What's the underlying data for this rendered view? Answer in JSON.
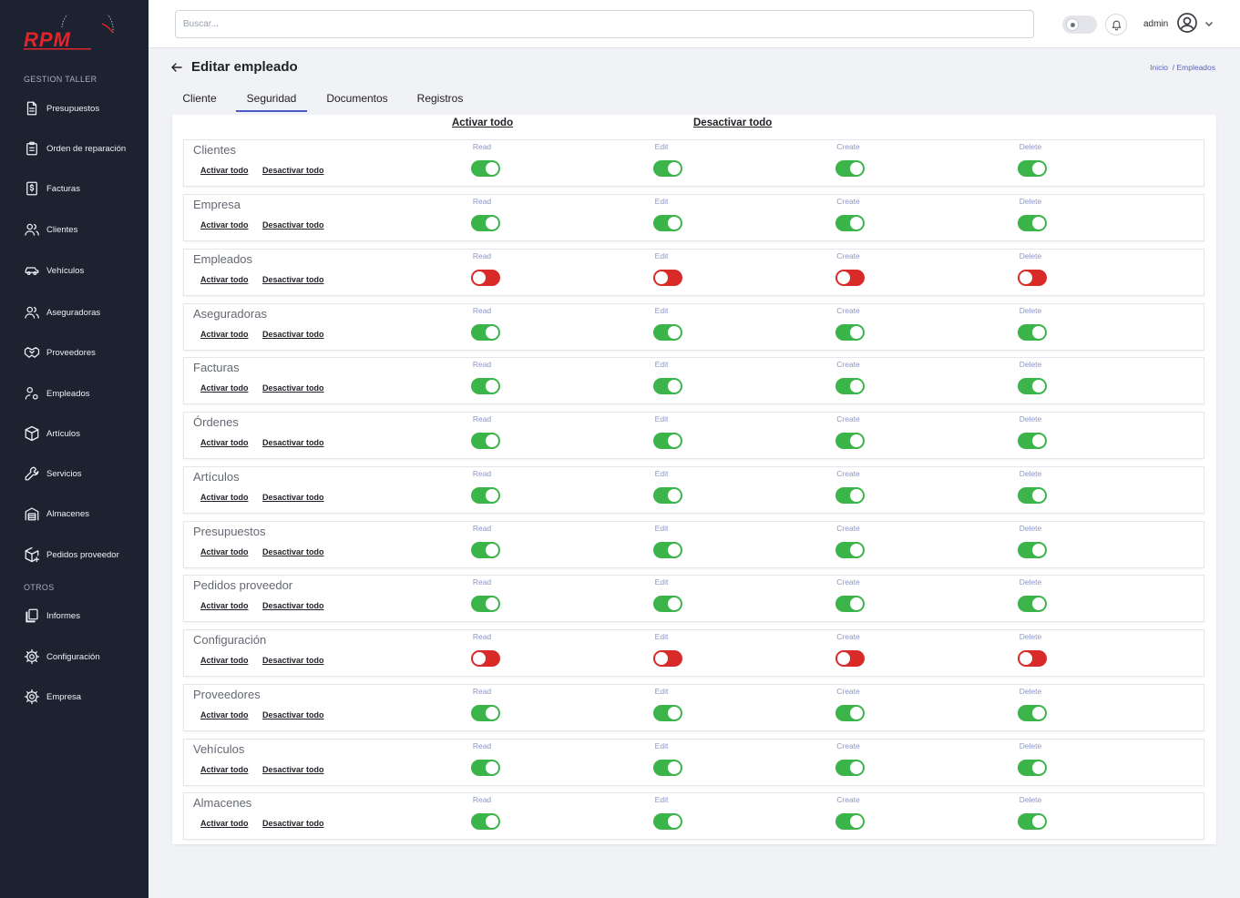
{
  "brand": {
    "logo_text": "RPM",
    "accent": "#e1262b"
  },
  "sidebar": {
    "section_main": "GESTION TALLER",
    "section_other": "OTROS",
    "items": [
      {
        "label": "Presupuestos",
        "icon": "document-icon"
      },
      {
        "label": "Orden de reparación",
        "icon": "clipboard-icon"
      },
      {
        "label": "Facturas",
        "icon": "invoice-dollar-icon"
      },
      {
        "label": "Clientes",
        "icon": "users-icon"
      },
      {
        "label": "Vehículos",
        "icon": "car-icon"
      },
      {
        "label": "Aseguradoras",
        "icon": "users-icon"
      },
      {
        "label": "Proveedores",
        "icon": "handshake-icon"
      },
      {
        "label": "Empleados",
        "icon": "user-cog-icon"
      },
      {
        "label": "Artículos",
        "icon": "box-icon"
      },
      {
        "label": "Servicios",
        "icon": "wrench-icon"
      },
      {
        "label": "Almacenes",
        "icon": "warehouse-icon"
      },
      {
        "label": "Pedidos proveedor",
        "icon": "package-plus-icon"
      }
    ],
    "other_items": [
      {
        "label": "Informes",
        "icon": "files-icon"
      },
      {
        "label": "Configuración",
        "icon": "gear-icon"
      },
      {
        "label": "Empresa",
        "icon": "gear-icon"
      }
    ]
  },
  "header": {
    "search_placeholder": "Buscar...",
    "user_name": "admin"
  },
  "page": {
    "title": "Editar empleado",
    "breadcrumb": [
      "Inicio",
      "/ Empleados"
    ],
    "tabs": [
      "Cliente",
      "Seguridad",
      "Documentos",
      "Registros"
    ],
    "active_tab": "Seguridad"
  },
  "security": {
    "activate_all": "Activar todo",
    "deactivate_all": "Desactivar todo",
    "row_activate": "Activar todo",
    "row_deactivate": "Desactivar todo",
    "permissions": [
      "Read",
      "Edit",
      "Create",
      "Delete"
    ],
    "on_color": "#3bb54a",
    "off_color": "#d92a2a",
    "modules": [
      {
        "name": "Clientes",
        "values": [
          true,
          true,
          true,
          true
        ]
      },
      {
        "name": "Empresa",
        "values": [
          true,
          true,
          true,
          true
        ]
      },
      {
        "name": "Empleados",
        "values": [
          false,
          false,
          false,
          false
        ]
      },
      {
        "name": "Aseguradoras",
        "values": [
          true,
          true,
          true,
          true
        ]
      },
      {
        "name": "Facturas",
        "values": [
          true,
          true,
          true,
          true
        ]
      },
      {
        "name": "Órdenes",
        "values": [
          true,
          true,
          true,
          true
        ]
      },
      {
        "name": "Artículos",
        "values": [
          true,
          true,
          true,
          true
        ]
      },
      {
        "name": "Presupuestos",
        "values": [
          true,
          true,
          true,
          true
        ]
      },
      {
        "name": "Pedidos proveedor",
        "values": [
          true,
          true,
          true,
          true
        ]
      },
      {
        "name": "Configuración",
        "values": [
          false,
          false,
          false,
          false
        ]
      },
      {
        "name": "Proveedores",
        "values": [
          true,
          true,
          true,
          true
        ]
      },
      {
        "name": "Vehículos",
        "values": [
          true,
          true,
          true,
          true
        ]
      },
      {
        "name": "Almacenes",
        "values": [
          true,
          true,
          true,
          true
        ]
      }
    ]
  }
}
